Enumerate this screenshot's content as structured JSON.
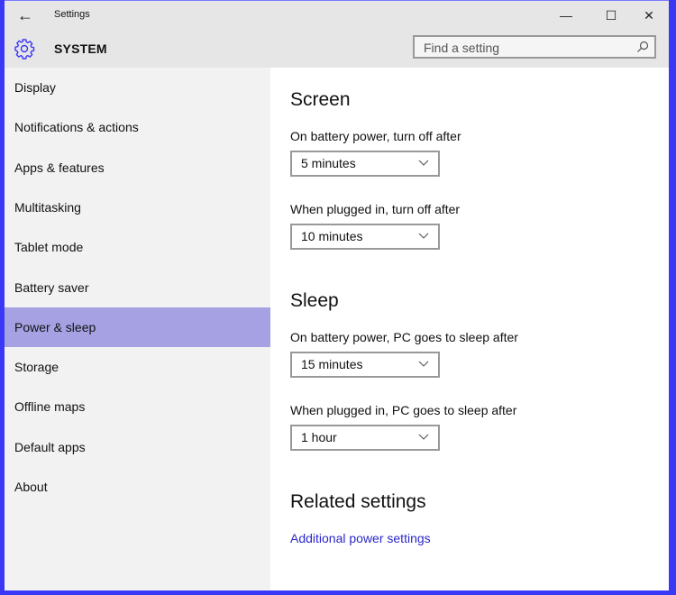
{
  "window": {
    "title": "Settings",
    "controls": {
      "minimize": "—",
      "maximize": "☐",
      "close": "✕"
    },
    "border_color": "#3b37f7"
  },
  "header": {
    "section": "SYSTEM",
    "search_placeholder": "Find a setting"
  },
  "sidebar": {
    "items": [
      {
        "label": "Display"
      },
      {
        "label": "Notifications & actions"
      },
      {
        "label": "Apps & features"
      },
      {
        "label": "Multitasking"
      },
      {
        "label": "Tablet mode"
      },
      {
        "label": "Battery saver"
      },
      {
        "label": "Power & sleep",
        "selected": true
      },
      {
        "label": "Storage"
      },
      {
        "label": "Offline maps"
      },
      {
        "label": "Default apps"
      },
      {
        "label": "About"
      }
    ],
    "selected_color": "#a5a1e3"
  },
  "main": {
    "screen": {
      "heading": "Screen",
      "battery_label": "On battery power, turn off after",
      "battery_value": "5 minutes",
      "plugged_label": "When plugged in, turn off after",
      "plugged_value": "10 minutes"
    },
    "sleep": {
      "heading": "Sleep",
      "battery_label": "On battery power, PC goes to sleep after",
      "battery_value": "15 minutes",
      "plugged_label": "When plugged in, PC goes to sleep after",
      "plugged_value": "1 hour"
    },
    "related": {
      "heading": "Related settings",
      "link": "Additional power settings",
      "link_color": "#2a27c9"
    }
  }
}
